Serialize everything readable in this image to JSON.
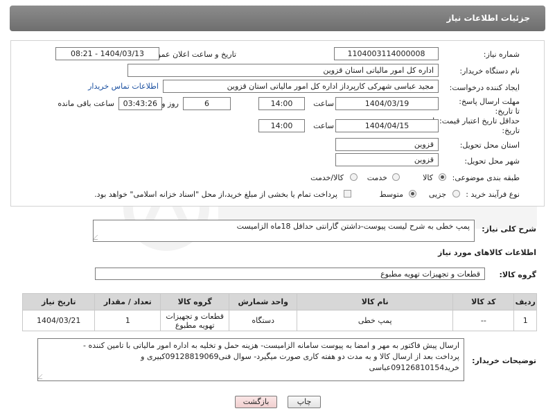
{
  "header": {
    "title": "جزئیات اطلاعات نیاز"
  },
  "form": {
    "need_number": {
      "label": "شماره نیاز:",
      "value": "1104003114000008"
    },
    "announce_datetime": {
      "label": "تاریخ و ساعت اعلان عمومی:",
      "value": "1404/03/13 - 08:21"
    },
    "buyer_org": {
      "label": "نام دستگاه خریدار:",
      "value": "اداره کل امور مالیاتی استان قزوین"
    },
    "requester": {
      "label": "ایجاد کننده درخواست:",
      "value": "مجید عباسی شهرکی کارپرداز اداره کل امور مالیاتی استان قزوین",
      "contact_link": "اطلاعات تماس خریدار"
    },
    "reply_deadline": {
      "label": "مهلت ارسال پاسخ: تا تاریخ:",
      "date": "1404/03/19",
      "time_label": "ساعت",
      "time": "14:00",
      "days": "6",
      "days_label": "روز و",
      "remaining": "03:43:26",
      "remaining_label": "ساعت باقی مانده"
    },
    "price_validity": {
      "label": "حداقل تاریخ اعتبار قیمت: تا تاریخ:",
      "date": "1404/04/15",
      "time_label": "ساعت",
      "time": "14:00"
    },
    "delivery_province": {
      "label": "استان محل تحویل:",
      "value": "قزوین"
    },
    "delivery_city": {
      "label": "شهر محل تحویل:",
      "value": "قزوین"
    },
    "category": {
      "label": "طبقه بندی موضوعی:",
      "options": [
        "کالا",
        "خدمت",
        "کالا/خدمت"
      ],
      "selected": "کالا"
    },
    "process_type": {
      "label": "نوع فرآیند خرید :",
      "options": [
        "جزیی",
        "متوسط"
      ],
      "selected": "متوسط",
      "payment_note": "پرداخت تمام یا بخشی از مبلغ خرید،از محل \"اسناد خزانه اسلامی\" خواهد بود."
    }
  },
  "summary": {
    "label": "شرح کلی نیاز:",
    "value": "پمپ خطی به شرح لیست پیوست-داشتن گارانتی حداقل 18ماه الزامیست"
  },
  "goods_section": {
    "title": "اطلاعات کالاهای مورد نیاز",
    "group_label": "گروه کالا:",
    "group_value": "قطعات و تجهیزات تهویه مطبوع"
  },
  "table": {
    "headers": [
      "ردیف",
      "کد کالا",
      "نام کالا",
      "واحد شمارش",
      "گروه کالا",
      "تعداد / مقدار",
      "تاریخ نیاز"
    ],
    "rows": [
      [
        "1",
        "--",
        "پمپ خطی",
        "دستگاه",
        "قطعات و تجهیزات تهویه مطبوع",
        "1",
        "1404/03/21"
      ]
    ]
  },
  "buyer_notes": {
    "label": "توضیحات خریدار:",
    "lines": [
      "ارسال پیش فاکتور به مهر و امضا به پیوست سامانه الزامیست- هزینه حمل و تخلیه به اداره امور مالیاتی با تامین کننده -",
      "پرداخت بعد از ارسال کالا و به مدت دو هفته کاری صورت میگیرد- سوال فنی09128819069کبیری و",
      "خرید09126810154عباسی"
    ]
  },
  "buttons": {
    "print": "چاپ",
    "back": "بازگشت"
  }
}
